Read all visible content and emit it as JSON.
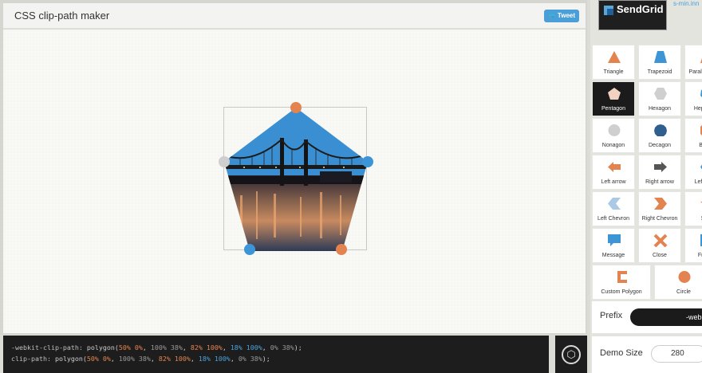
{
  "header": {
    "title": "CSS clip-path maker",
    "tweet_label": "Tweet"
  },
  "code": {
    "line1": {
      "prop": "-webkit-clip-path:",
      "fn": " polygon(",
      "p1": "50% 0%",
      "p2": "100% 38%",
      "p3": "82% 100%",
      "p4": "18% 100%",
      "p5": "0% 38%",
      "end": ");"
    },
    "line2": {
      "prop": "clip-path:",
      "fn": " polygon(",
      "p1": "50% 0%",
      "p2": "100% 38%",
      "p3": "82% 100%",
      "p4": "18% 100%",
      "p5": "0% 38%",
      "end": ");"
    }
  },
  "sidebar": {
    "ad_brand": "SendGrid",
    "ad_link": "s-min.inn",
    "shapes": [
      {
        "label": "Triangle",
        "icon": "triangle-icon"
      },
      {
        "label": "Trapezoid",
        "icon": "trapezoid-icon"
      },
      {
        "label": "Parallelogram",
        "icon": "parallelogram-icon"
      },
      {
        "label": "Pentagon",
        "icon": "pentagon-icon",
        "active": true
      },
      {
        "label": "Hexagon",
        "icon": "hexagon-icon"
      },
      {
        "label": "Heptagon",
        "icon": "heptagon-icon"
      },
      {
        "label": "Nonagon",
        "icon": "nonagon-icon"
      },
      {
        "label": "Decagon",
        "icon": "decagon-icon"
      },
      {
        "label": "Bevel",
        "icon": "bevel-icon"
      },
      {
        "label": "Left arrow",
        "icon": "left-arrow-icon"
      },
      {
        "label": "Right arrow",
        "icon": "right-arrow-icon"
      },
      {
        "label": "Left point",
        "icon": "left-point-icon"
      },
      {
        "label": "Left Chevron",
        "icon": "left-chevron-icon"
      },
      {
        "label": "Right Chevron",
        "icon": "right-chevron-icon"
      },
      {
        "label": "Star",
        "icon": "star-icon"
      },
      {
        "label": "Message",
        "icon": "message-icon"
      },
      {
        "label": "Close",
        "icon": "close-icon"
      },
      {
        "label": "Frame",
        "icon": "frame-icon"
      },
      {
        "label": "Custom Polygon",
        "icon": "custom-polygon-icon"
      },
      {
        "label": "Circle",
        "icon": "circle-icon"
      }
    ],
    "prefix_label": "Prefix",
    "prefix_value": "-webkit-",
    "demo_label": "Demo Size",
    "demo_value": "280"
  },
  "colors": {
    "orange": "#e3834f",
    "blue": "#3e95d6",
    "gray": "#cfcfcf"
  }
}
